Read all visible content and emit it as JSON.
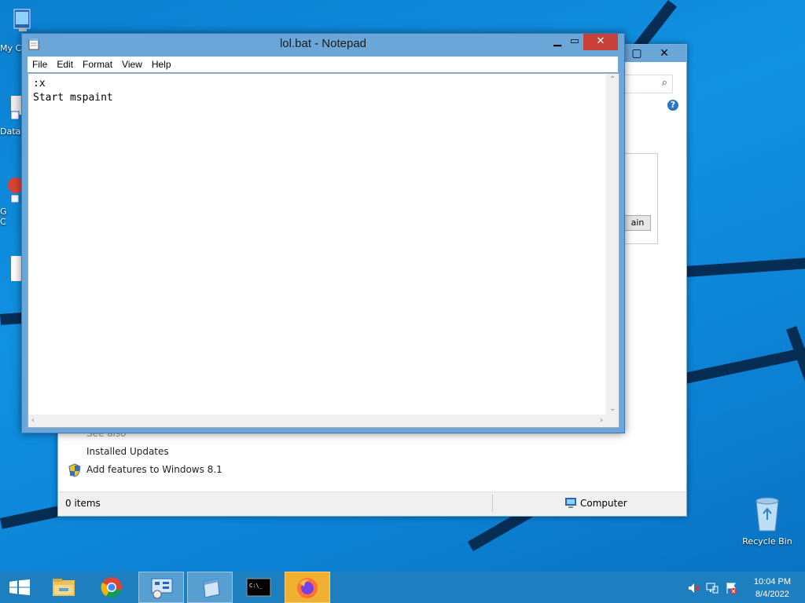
{
  "desktop": {
    "icons": [
      {
        "label": "My C"
      },
      {
        "label": "Data"
      },
      {
        "label": "G\nC"
      },
      {
        "label": "Recycle Bin"
      }
    ]
  },
  "background_window": {
    "partial_button_text": "ain",
    "see_also": "See also",
    "links": [
      "Installed Updates",
      "Add features to Windows 8.1"
    ],
    "status_items": "0 items",
    "status_computer": "Computer"
  },
  "notepad": {
    "title": "lol.bat - Notepad",
    "menu": [
      "File",
      "Edit",
      "Format",
      "View",
      "Help"
    ],
    "content": ":x\nStart mspaint"
  },
  "taskbar": {
    "items": [
      "start",
      "file-explorer",
      "chrome",
      "control-panel",
      "notepad",
      "cmd",
      "firefox"
    ],
    "time": "10:04 PM",
    "date": "8/4/2022"
  }
}
